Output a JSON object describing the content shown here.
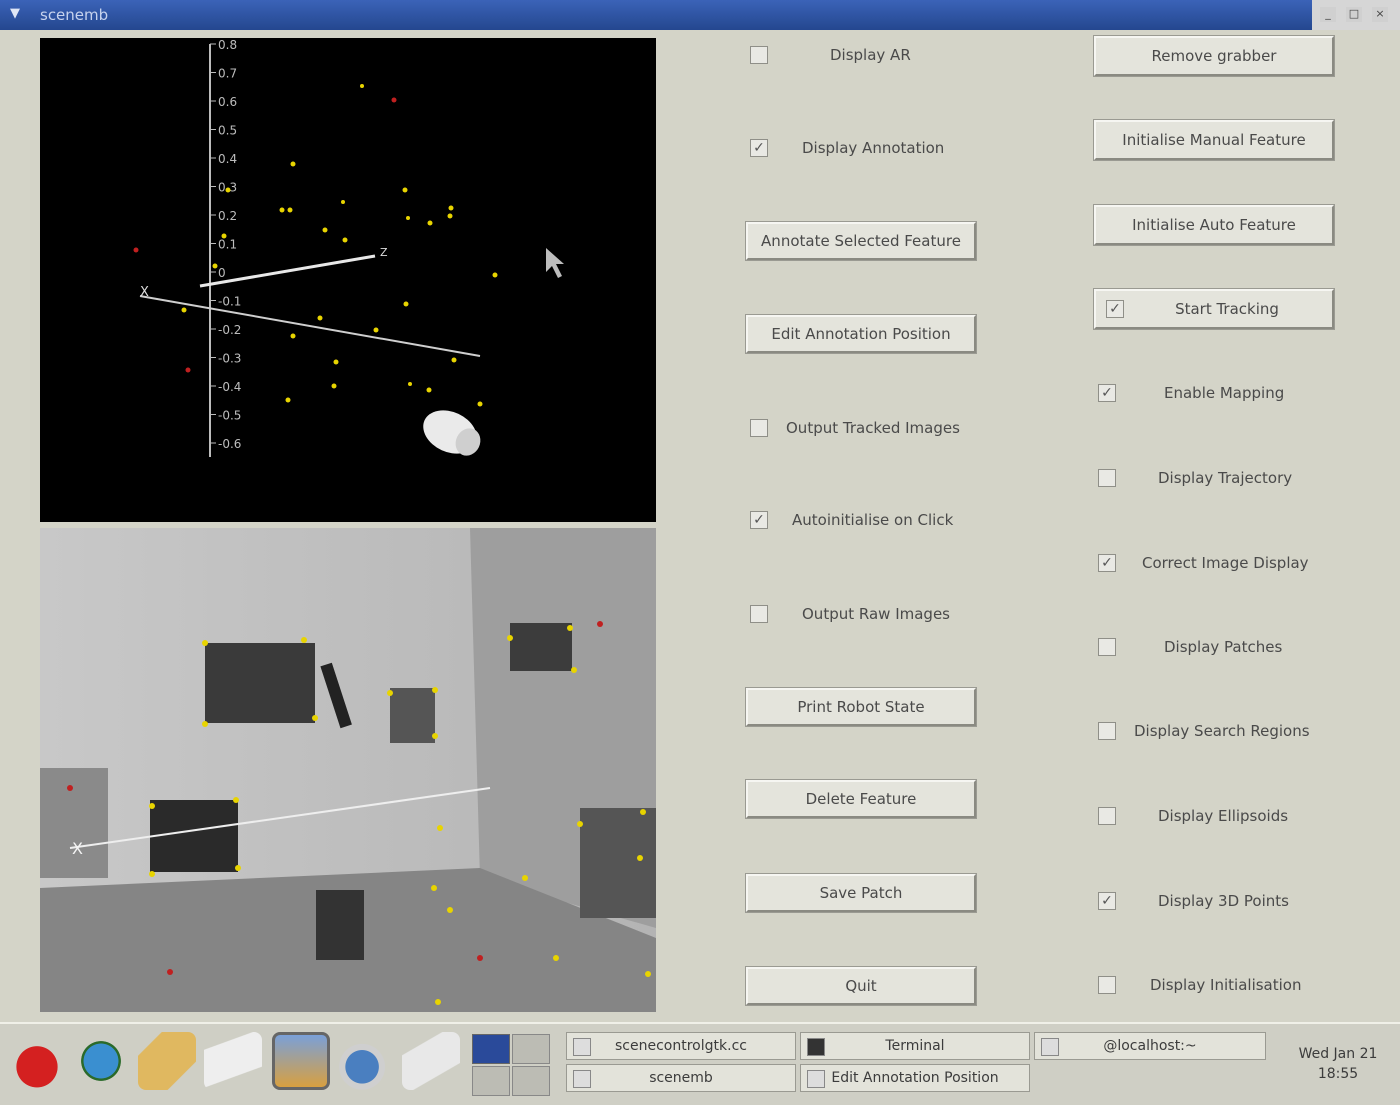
{
  "window": {
    "title": "scenemb"
  },
  "title_controls": [
    "_",
    "□",
    "×"
  ],
  "view3d": {
    "y_ticks": [
      "0.8",
      "0.7",
      "0.6",
      "0.5",
      "0.4",
      "0.3",
      "0.2",
      "0.1",
      "0",
      "-0.1",
      "-0.2",
      "-0.3",
      "-0.4",
      "-0.5",
      "-0.6"
    ],
    "x_axis_label": "X",
    "z_axis_label": "Z"
  },
  "camera_view": {
    "axis_label": "X"
  },
  "left_controls": [
    {
      "type": "checkbox",
      "label": "Display AR",
      "checked": false
    },
    {
      "type": "checkbox",
      "label": "Display Annotation",
      "checked": true
    },
    {
      "type": "button",
      "label": "Annotate Selected Feature"
    },
    {
      "type": "button",
      "label": "Edit Annotation Position"
    },
    {
      "type": "checkbox",
      "label": "Output Tracked Images",
      "checked": false
    },
    {
      "type": "checkbox",
      "label": "Autoinitialise on Click",
      "checked": true
    },
    {
      "type": "checkbox",
      "label": "Output Raw Images",
      "checked": false
    },
    {
      "type": "button",
      "label": "Print Robot State"
    },
    {
      "type": "button",
      "label": "Delete Feature"
    },
    {
      "type": "button",
      "label": "Save Patch"
    },
    {
      "type": "button",
      "label": "Quit"
    }
  ],
  "right_controls": [
    {
      "type": "button",
      "label": "Remove grabber"
    },
    {
      "type": "button",
      "label": "Initialise Manual Feature"
    },
    {
      "type": "button",
      "label": "Initialise Auto Feature"
    },
    {
      "type": "toggle",
      "label": "Start Tracking",
      "checked": true
    },
    {
      "type": "checkbox",
      "label": "Enable Mapping",
      "checked": true
    },
    {
      "type": "checkbox",
      "label": "Display Trajectory",
      "checked": false
    },
    {
      "type": "checkbox",
      "label": "Correct Image Display",
      "checked": true
    },
    {
      "type": "checkbox",
      "label": "Display Patches",
      "checked": false
    },
    {
      "type": "checkbox",
      "label": "Display Search Regions",
      "checked": false
    },
    {
      "type": "checkbox",
      "label": "Display Ellipsoids",
      "checked": false
    },
    {
      "type": "checkbox",
      "label": "Display 3D Points",
      "checked": true
    },
    {
      "type": "checkbox",
      "label": "Display Initialisation",
      "checked": false
    }
  ],
  "taskbar": {
    "launchers": [
      "redhat-menu-icon",
      "web-browser-icon",
      "email-icon",
      "office-icon",
      "graphics-icon",
      "system-icon",
      "printer-icon"
    ],
    "tasks": [
      {
        "label": "scenecontrolgtk.cc"
      },
      {
        "label": "scenemb"
      },
      {
        "label": "Terminal"
      },
      {
        "label": "Edit Annotation Position"
      },
      {
        "label": "@localhost:~"
      }
    ],
    "clock_day": "Wed Jan 21",
    "clock_time": "18:55"
  },
  "colors": {
    "background": "#d4d4c8",
    "titlebar": "#2f58a8",
    "feature_yellow": "#e8d400",
    "feature_red": "#c02020"
  }
}
